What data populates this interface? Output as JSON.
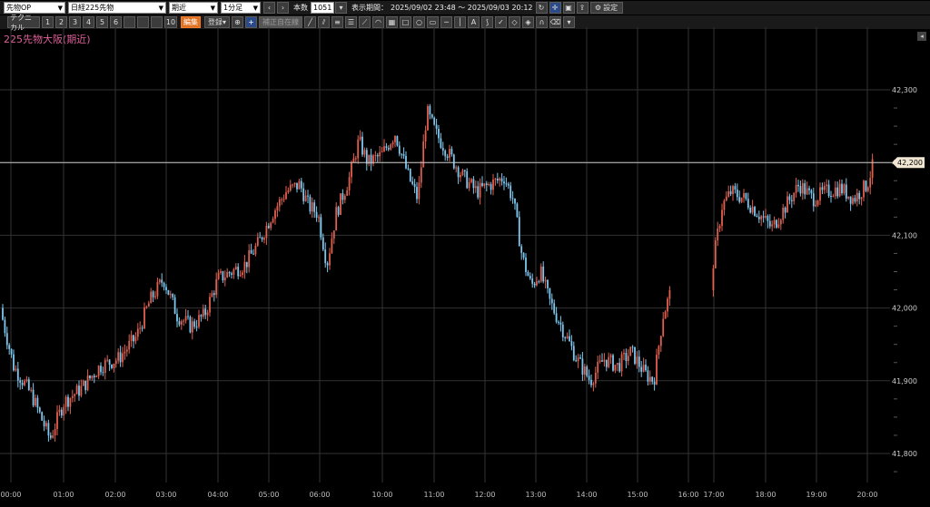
{
  "toolbar1": {
    "instrument_select": "先物OP",
    "symbol_select": "日経225先物",
    "contract_select": "期近",
    "interval_select": "1分足",
    "count_label": "本数",
    "count_value": "1051",
    "period_label": "表示期間：",
    "period_value": "2025/09/02 23:48 ～ 2025/09/03 20:12",
    "settings_label": "設定"
  },
  "toolbar2": {
    "technical_label": "テクニカル",
    "slots": [
      "1",
      "2",
      "3",
      "4",
      "5",
      "6",
      "",
      "",
      "",
      "10"
    ],
    "edit_label": "編集",
    "register_label": "登録",
    "cursor_label": "補正自在線"
  },
  "chart_data": {
    "type": "candlestick",
    "title": "225先物大阪(期近)",
    "current_price": "42,200",
    "y_ticks": [
      {
        "value": 42300,
        "label": "42,300"
      },
      {
        "value": 42200,
        "label": "42,200"
      },
      {
        "value": 42100,
        "label": "42,100"
      },
      {
        "value": 42000,
        "label": "42,000"
      },
      {
        "value": 41900,
        "label": "41,900"
      },
      {
        "value": 41800,
        "label": "41,800"
      }
    ],
    "ylim": [
      41760,
      42340
    ],
    "x_ticks": [
      "00:00",
      "01:00",
      "02:00",
      "03:00",
      "04:00",
      "05:00",
      "06:00",
      "10:00",
      "11:00",
      "12:00",
      "13:00",
      "14:00",
      "15:00",
      "16:00",
      "17:00",
      "18:00",
      "19:00",
      "20:00"
    ],
    "colors": {
      "up": "#e06050",
      "down": "#7ec8ef",
      "grid": "#333333",
      "price_line": "#c8c8c8"
    },
    "price_path": [
      [
        0,
        42000
      ],
      [
        15,
        41920
      ],
      [
        35,
        41880
      ],
      [
        55,
        41820
      ],
      [
        70,
        41870
      ],
      [
        90,
        41890
      ],
      [
        110,
        41920
      ],
      [
        130,
        41930
      ],
      [
        150,
        41960
      ],
      [
        165,
        42010
      ],
      [
        180,
        42040
      ],
      [
        195,
        41990
      ],
      [
        210,
        41975
      ],
      [
        225,
        41990
      ],
      [
        240,
        42040
      ],
      [
        255,
        42050
      ],
      [
        270,
        42060
      ],
      [
        285,
        42090
      ],
      [
        300,
        42130
      ],
      [
        315,
        42160
      ],
      [
        330,
        42170
      ],
      [
        340,
        42140
      ],
      [
        350,
        42130
      ],
      [
        360,
        42060
      ],
      [
        370,
        42130
      ],
      [
        385,
        42180
      ],
      [
        395,
        42230
      ],
      [
        405,
        42200
      ],
      [
        420,
        42210
      ],
      [
        435,
        42240
      ],
      [
        450,
        42180
      ],
      [
        460,
        42150
      ],
      [
        470,
        42270
      ],
      [
        480,
        42240
      ],
      [
        495,
        42210
      ],
      [
        510,
        42180
      ],
      [
        525,
        42160
      ],
      [
        540,
        42170
      ],
      [
        555,
        42180
      ],
      [
        565,
        42150
      ],
      [
        575,
        42070
      ],
      [
        585,
        42030
      ],
      [
        595,
        42050
      ],
      [
        605,
        42010
      ],
      [
        620,
        41970
      ],
      [
        635,
        41930
      ],
      [
        650,
        41900
      ],
      [
        665,
        41930
      ],
      [
        680,
        41920
      ],
      [
        695,
        41940
      ],
      [
        710,
        41910
      ],
      [
        720,
        41900
      ],
      [
        730,
        41990
      ],
      [
        738,
        42020
      ],
      [
        785,
        42060
      ],
      [
        795,
        42140
      ],
      [
        805,
        42160
      ],
      [
        820,
        42150
      ],
      [
        835,
        42130
      ],
      [
        850,
        42110
      ],
      [
        865,
        42140
      ],
      [
        880,
        42170
      ],
      [
        895,
        42150
      ],
      [
        910,
        42160
      ],
      [
        925,
        42165
      ],
      [
        940,
        42150
      ],
      [
        955,
        42170
      ],
      [
        962,
        42200
      ]
    ]
  }
}
